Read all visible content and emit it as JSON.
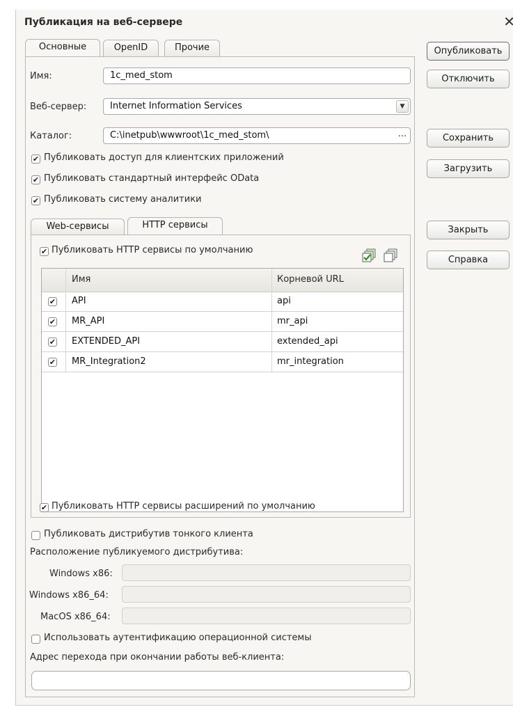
{
  "window": {
    "title": "Публикация на веб-сервере"
  },
  "tabs": [
    "Основные",
    "OpenID",
    "Прочие"
  ],
  "fields": {
    "name": {
      "label": "Имя:",
      "value": "1c_med_stom"
    },
    "webserver": {
      "label": "Веб-сервер:",
      "value": "Internet Information Services"
    },
    "catalog": {
      "label": "Каталог:",
      "value": "C:\\inetpub\\wwwroot\\1c_med_stom\\",
      "browse": "..."
    }
  },
  "options": {
    "publish_client_access": {
      "label": "Публиковать доступ для клиентских приложений",
      "checked": true
    },
    "publish_odata": {
      "label": "Публиковать стандартный интерфейс OData",
      "checked": true
    },
    "publish_analytics": {
      "label": "Публиковать систему аналитики",
      "checked": true
    }
  },
  "inner_tabs": [
    "Web-сервисы",
    "HTTP сервисы"
  ],
  "http": {
    "publish_default": {
      "label": "Публиковать HTTP сервисы по умолчанию",
      "checked": true
    },
    "columns": [
      "Имя",
      "Корневой URL"
    ],
    "rows": [
      {
        "checked": true,
        "name": "API",
        "url": "api"
      },
      {
        "checked": true,
        "name": "MR_API",
        "url": "mr_api"
      },
      {
        "checked": true,
        "name": "EXTENDED_API",
        "url": "extended_api"
      },
      {
        "checked": true,
        "name": "MR_Integration2",
        "url": "mr_integration"
      }
    ],
    "publish_extensions": {
      "label": "Публиковать HTTP сервисы расширений по умолчанию",
      "checked": true
    }
  },
  "distrib": {
    "publish_thin_client": {
      "label": "Публиковать дистрибутив тонкого клиента",
      "checked": false
    },
    "location_label": "Расположение публикуемого дистрибутива:",
    "win86": {
      "label": "Windows x86:",
      "value": ""
    },
    "win64": {
      "label": "Windows x86_64:",
      "value": ""
    },
    "mac64": {
      "label": "MacOS x86_64:",
      "value": ""
    }
  },
  "os_auth": {
    "label": "Использовать аутентификацию операционной системы",
    "checked": false
  },
  "exit_url": {
    "label": "Адрес перехода при окончании работы веб-клиента:",
    "value": ""
  },
  "buttons": {
    "publish": "Опубликовать",
    "disable": "Отключить",
    "save": "Сохранить",
    "load": "Загрузить",
    "close": "Закрыть",
    "help": "Справка"
  },
  "close_glyph": "✕",
  "check_glyph": "✔",
  "dropdown_glyph": "▼"
}
